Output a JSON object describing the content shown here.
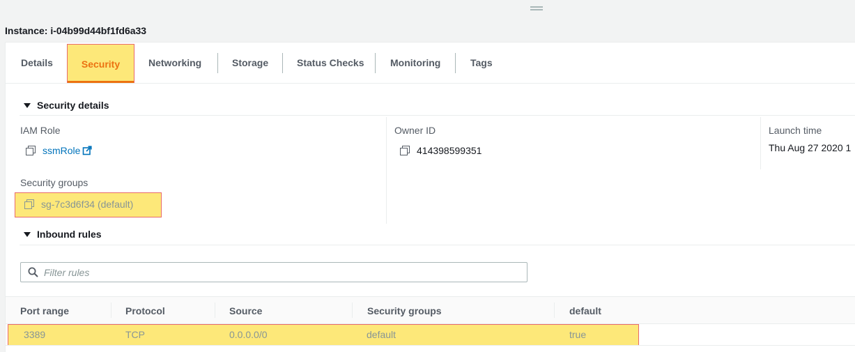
{
  "instance_title": "Instance: i-04b99d44bf1fd6a33",
  "tabs": [
    {
      "label": "Details"
    },
    {
      "label": "Security"
    },
    {
      "label": "Networking"
    },
    {
      "label": "Storage"
    },
    {
      "label": "Status Checks"
    },
    {
      "label": "Monitoring"
    },
    {
      "label": "Tags"
    }
  ],
  "active_tab": "Security",
  "security_details": {
    "header": "Security details",
    "iam_role_label": "IAM Role",
    "iam_role_value": "ssmRole",
    "owner_id_label": "Owner ID",
    "owner_id_value": "414398599351",
    "launch_time_label": "Launch time",
    "launch_time_value": "Thu Aug 27 2020 1",
    "security_groups_label": "Security groups",
    "security_groups_value": "sg-7c3d6f34 (default)"
  },
  "inbound_rules": {
    "header": "Inbound rules",
    "filter_placeholder": "Filter rules",
    "columns": [
      "Port range",
      "Protocol",
      "Source",
      "Security groups",
      "default"
    ],
    "rows": [
      {
        "port_range": "3389",
        "protocol": "TCP",
        "source": "0.0.0.0/0",
        "security_groups": "default",
        "default": "true"
      }
    ]
  },
  "colors": {
    "accent": "#ec7211",
    "link": "#0073bb",
    "highlight": "#fde879",
    "highlight_border": "#e86a6a"
  },
  "icons": [
    "drag-handle-icon",
    "caret-down-icon",
    "copy-icon",
    "external-link-icon",
    "search-icon"
  ]
}
